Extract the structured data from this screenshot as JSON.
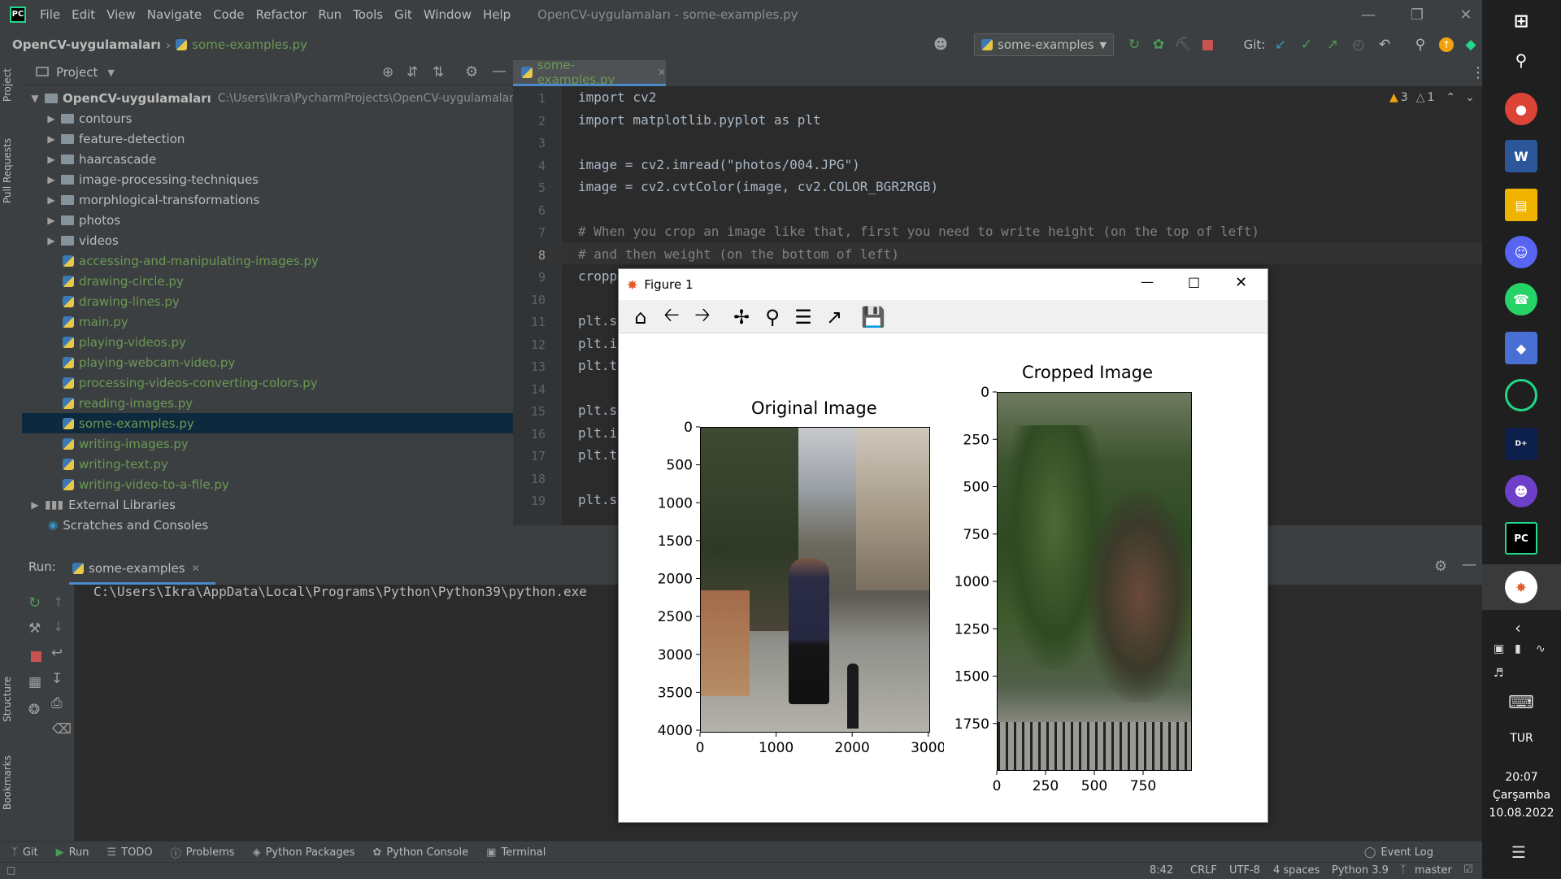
{
  "menubar": {
    "items": [
      "File",
      "Edit",
      "View",
      "Navigate",
      "Code",
      "Refactor",
      "Run",
      "Tools",
      "Git",
      "Window",
      "Help"
    ],
    "window_title": "OpenCV-uygulamaları - some-examples.py"
  },
  "navbar": {
    "project": "OpenCV-uygulamaları",
    "file": "some-examples.py",
    "run_config": "some-examples",
    "git_label": "Git:"
  },
  "sidebar_tabs": [
    "Project",
    "Pull Requests",
    "Structure",
    "Bookmarks"
  ],
  "project_panel": {
    "title": "Project",
    "root_name": "OpenCV-uygulamaları",
    "root_path": "C:\\Users\\Ikra\\PycharmProjects\\OpenCV-uygulamaları",
    "folders": [
      "contours",
      "feature-detection",
      "haarcascade",
      "image-processing-techniques",
      "morphlogical-transformations",
      "photos",
      "videos"
    ],
    "files": [
      "accessing-and-manipulating-images.py",
      "drawing-circle.py",
      "drawing-lines.py",
      "main.py",
      "playing-videos.py",
      "playing-webcam-video.py",
      "processing-videos-converting-colors.py",
      "reading-images.py",
      "some-examples.py",
      "writing-images.py",
      "writing-text.py",
      "writing-video-to-a-file.py"
    ],
    "selected_file": "some-examples.py",
    "external": "External Libraries",
    "scratches": "Scratches and Consoles"
  },
  "editor": {
    "tab": "some-examples.py",
    "warnings": "3",
    "weak_warnings": "1",
    "line_numbers": [
      "1",
      "2",
      "3",
      "4",
      "5",
      "6",
      "7",
      "8",
      "9",
      "10",
      "11",
      "12",
      "13",
      "14",
      "15",
      "16",
      "17",
      "18",
      "19"
    ],
    "lines": {
      "l1": "import cv2",
      "l2": "import matplotlib.pyplot as plt",
      "l4": "image = cv2.imread(\"photos/004.JPG\")",
      "l5": "image = cv2.cvtColor(image, cv2.COLOR_BGR2RGB)",
      "l7": "# When you crop an image like that, first you need to write height (on the top of left)",
      "l8": "# and then weight (on the bottom of left)",
      "l9": "cropp",
      "l11": "plt.s",
      "l12": "plt.i",
      "l13": "plt.t",
      "l15": "plt.s",
      "l16": "plt.i",
      "l17": "plt.t",
      "l19": "plt.s"
    }
  },
  "run_panel": {
    "label": "Run:",
    "tab": "some-examples",
    "console_line": "C:\\Users\\Ikra\\AppData\\Local\\Programs\\Python\\Python39\\python.exe"
  },
  "bottom_tabs": [
    "Git",
    "Run",
    "TODO",
    "Problems",
    "Python Packages",
    "Python Console",
    "Terminal"
  ],
  "event_log": "Event Log",
  "status": {
    "position": "8:42",
    "line_sep": "CRLF",
    "encoding": "UTF-8",
    "indent": "4 spaces",
    "interpreter": "Python 3.9",
    "branch": "master"
  },
  "figure": {
    "title": "Figure 1"
  },
  "chart_data": [
    {
      "type": "image",
      "title": "Original Image",
      "xticks": [
        "0",
        "1000",
        "2000",
        "3000"
      ],
      "yticks": [
        "0",
        "500",
        "1000",
        "1500",
        "2000",
        "2500",
        "3000",
        "3500",
        "4000"
      ],
      "xlim": [
        0,
        3024
      ],
      "ylim": [
        4032,
        0
      ]
    },
    {
      "type": "image",
      "title": "Cropped Image",
      "xticks": [
        "0",
        "250",
        "500",
        "750"
      ],
      "yticks": [
        "0",
        "250",
        "500",
        "750",
        "1000",
        "1250",
        "1500",
        "1750"
      ],
      "xlim": [
        0,
        1000
      ],
      "ylim": [
        2000,
        0
      ]
    }
  ],
  "taskbar": {
    "lang": "TUR",
    "time": "20:07",
    "day": "Çarşamba",
    "date": "10.08.2022"
  }
}
